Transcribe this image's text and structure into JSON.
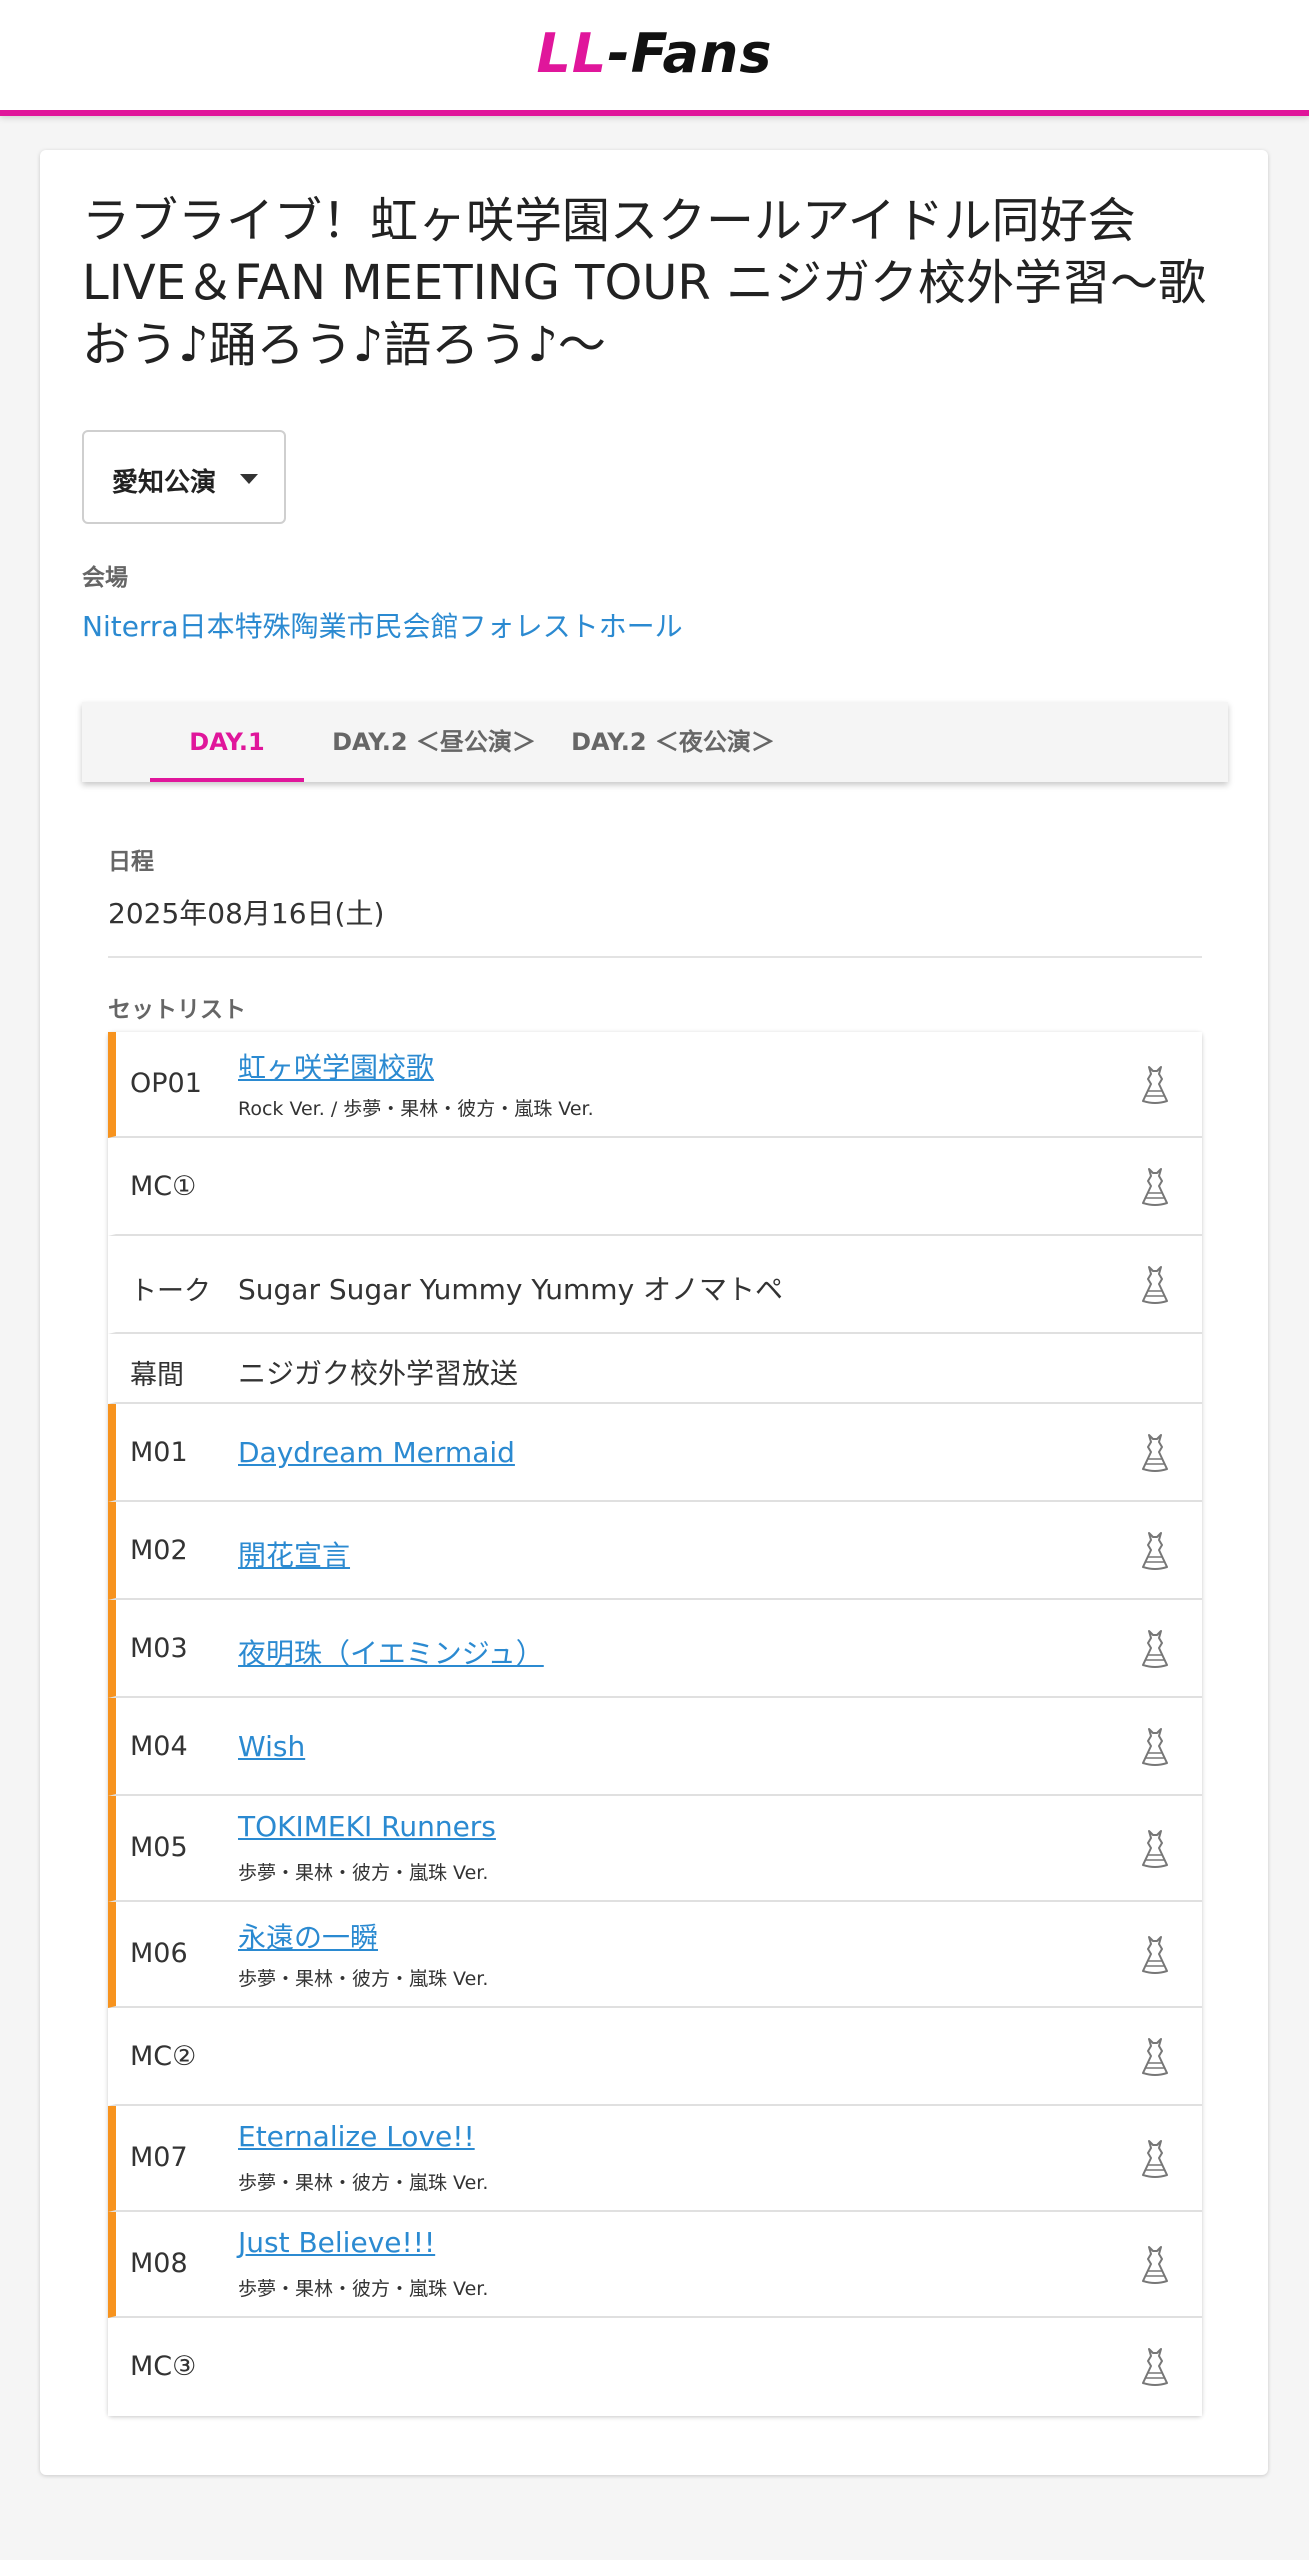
{
  "header": {
    "logo_ll": "LL",
    "logo_rest": "-Fans"
  },
  "page": {
    "title": "ラブライブ！虹ヶ咲学園スクールアイドル同好会 LIVE＆FAN MEETING TOUR ニジガク校外学習〜歌おう♪踊ろう♪語ろう♪〜",
    "performance_select": "愛知公演",
    "venue_label": "会場",
    "venue": "Niterra日本特殊陶業市民会館フォレストホール"
  },
  "tabs": [
    {
      "label": "DAY.1",
      "active": true
    },
    {
      "label": "DAY.2 ＜昼公演＞",
      "active": false
    },
    {
      "label": "DAY.2 ＜夜公演＞",
      "active": false
    }
  ],
  "schedule": {
    "label": "日程",
    "value": "2025年08月16日(土)"
  },
  "setlist": {
    "label": "セットリスト",
    "costume_icon": "dress-icon",
    "accent_color": "#f7931e",
    "rows": [
      {
        "num": "OP01",
        "title": "虹ヶ咲学園校歌",
        "sub": "Rock Ver. / 歩夢・果林・彼方・嵐珠 Ver.",
        "song": true
      },
      {
        "num": "MC①",
        "title": "",
        "sub": "",
        "song": false
      },
      {
        "num": "トーク",
        "title": "Sugar Sugar Yummy Yummy オノマトペ",
        "sub": "",
        "song": false
      },
      {
        "num": "幕間",
        "title": "ニジガク校外学習放送",
        "sub": "",
        "song": false
      },
      {
        "num": "M01",
        "title": "Daydream Mermaid",
        "sub": "",
        "song": true
      },
      {
        "num": "M02",
        "title": "開花宣言",
        "sub": "",
        "song": true
      },
      {
        "num": "M03",
        "title": "夜明珠（イエミンジュ）",
        "sub": "",
        "song": true
      },
      {
        "num": "M04",
        "title": "Wish",
        "sub": "",
        "song": true
      },
      {
        "num": "M05",
        "title": "TOKIMEKI Runners",
        "sub": "歩夢・果林・彼方・嵐珠 Ver.",
        "song": true
      },
      {
        "num": "M06",
        "title": "永遠の一瞬",
        "sub": "歩夢・果林・彼方・嵐珠 Ver.",
        "song": true
      },
      {
        "num": "MC②",
        "title": "",
        "sub": "",
        "song": false
      },
      {
        "num": "M07",
        "title": "Eternalize Love!!",
        "sub": "歩夢・果林・彼方・嵐珠 Ver.",
        "song": true
      },
      {
        "num": "M08",
        "title": "Just Believe!!!",
        "sub": "歩夢・果林・彼方・嵐珠 Ver.",
        "song": true
      },
      {
        "num": "MC③",
        "title": "",
        "sub": "",
        "song": false
      }
    ]
  },
  "colors": {
    "brand": "#e0169b",
    "link": "#2b8ad1",
    "song_marker": "#f7931e"
  }
}
